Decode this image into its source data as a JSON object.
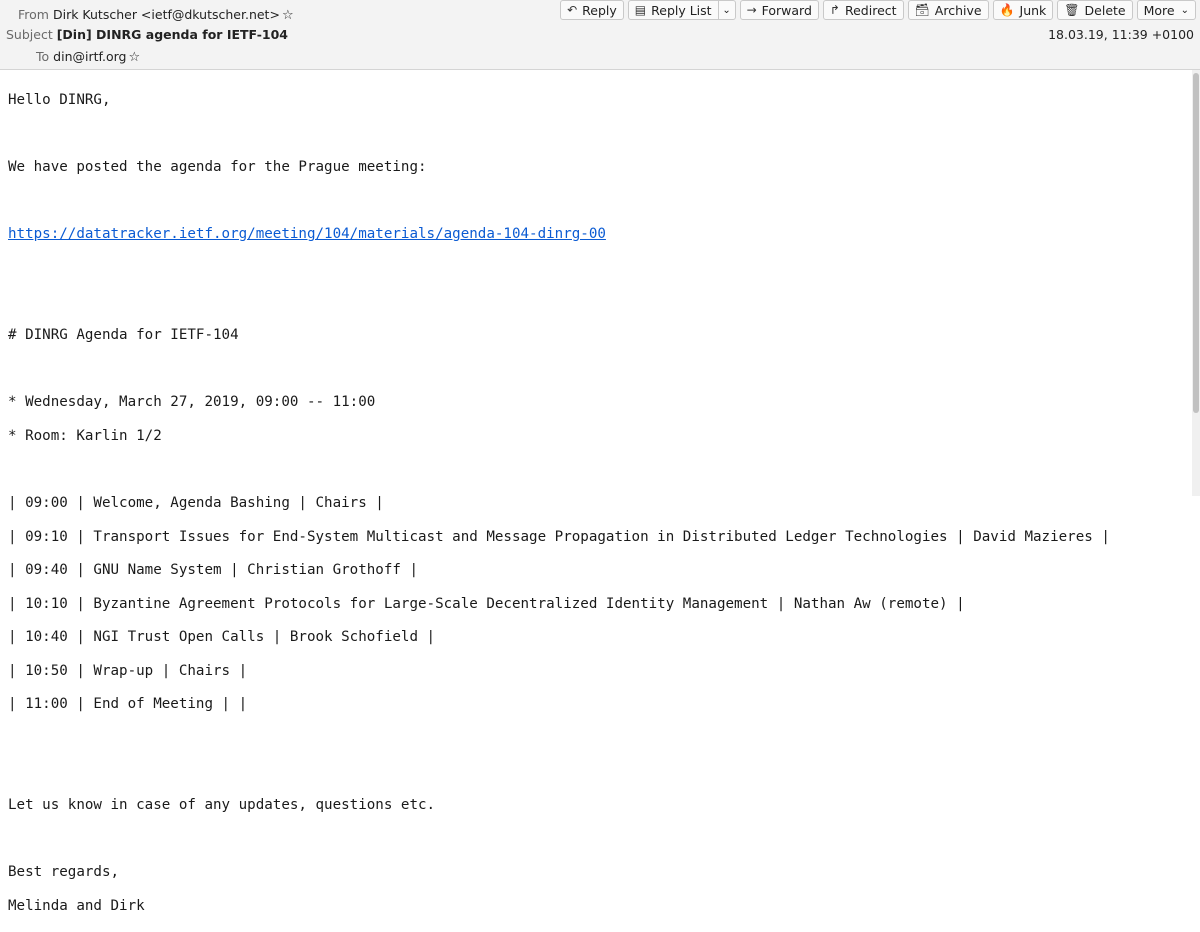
{
  "header": {
    "from_label": "From",
    "from_value": "Dirk Kutscher <ietf@dkutscher.net>",
    "subject_label": "Subject",
    "subject_value": "[Din] DINRG agenda for IETF-104",
    "to_label": "To",
    "to_value": "din@irtf.org",
    "date": "18.03.19, 11:39 +0100"
  },
  "toolbar": {
    "reply": "Reply",
    "reply_list": "Reply List",
    "forward": "Forward",
    "redirect": "Redirect",
    "archive": "Archive",
    "junk": "Junk",
    "delete": "Delete",
    "more": "More"
  },
  "icons": {
    "reply": "reply-icon",
    "reply_list": "reply-list-icon",
    "forward": "forward-icon",
    "redirect": "redirect-icon",
    "archive": "archive-icon",
    "junk": "junk-icon",
    "delete": "trash-icon",
    "star": "star-icon"
  },
  "message": {
    "greeting": "Hello DINRG,",
    "intro": "We have posted the agenda for the Prague meeting:",
    "link": "https://datatracker.ietf.org/meeting/104/materials/agenda-104-dinrg-00",
    "agenda_heading": "# DINRG Agenda for IETF-104",
    "date_line": "* Wednesday, March 27, 2019, 09:00 -- 11:00",
    "room_line": "* Room: Karlin 1/2",
    "agenda_rows": [
      "| 09:00 | Welcome, Agenda Bashing | Chairs |",
      "| 09:10 | Transport Issues for End-System Multicast and Message Propagation in Distributed Ledger Technologies | David Mazieres |",
      "| 09:40 | GNU Name System | Christian Grothoff |",
      "| 10:10 | Byzantine Agreement Protocols for Large-Scale Decentralized Identity Management | Nathan Aw (remote) |",
      "| 10:40 | NGI Trust Open Calls | Brook Schofield |",
      "| 10:50 | Wrap-up | Chairs |",
      "| 11:00 | End of Meeting | |"
    ],
    "closing": "Let us know in case of any updates, questions etc.",
    "regards": "Best regards,",
    "signature": "Melinda and Dirk"
  }
}
